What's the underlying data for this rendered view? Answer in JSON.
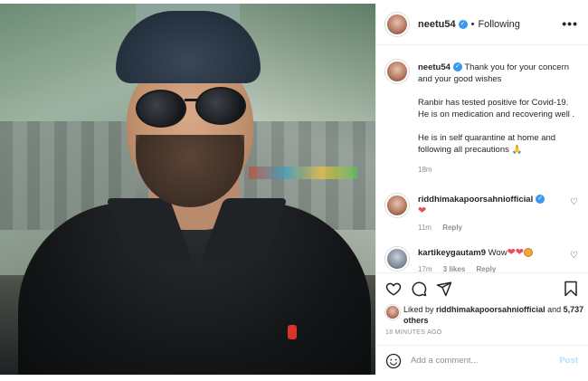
{
  "post": {
    "author": "neetu54",
    "separator": "•",
    "follow_status": "Following",
    "more_label": "•••"
  },
  "caption": {
    "author": "neetu54",
    "line1": "Thank you for your concern and your good wishes",
    "line2": "Ranbir has tested positive for Covid-19. He is on medication and recovering well .",
    "line3": "He is in self quarantine at home and following all precautions",
    "time": "18m"
  },
  "comments": [
    {
      "user": "riddhimakapoorsahniofficial",
      "text": "❤",
      "time": "11m",
      "reply_label": "Reply"
    },
    {
      "user": "kartikeygautam9",
      "text": "Wow",
      "time": "17m",
      "likes": "3 likes",
      "reply_label": "Reply"
    }
  ],
  "likes": {
    "prefix": "Liked by",
    "user": "riddhimakapoorsahniofficial",
    "conj": "and",
    "others": "5,737 others"
  },
  "timestamp": "18 MINUTES AGO",
  "add_comment": {
    "placeholder": "Add a comment...",
    "post_label": "Post"
  },
  "colors": {
    "verified": "#3897f0",
    "heart": "#ed4956",
    "post_disabled": "#b2dffc"
  },
  "icons": [
    "heart-icon",
    "comment-icon",
    "share-icon",
    "bookmark-icon",
    "emoji-icon",
    "more-icon",
    "verified-icon"
  ]
}
